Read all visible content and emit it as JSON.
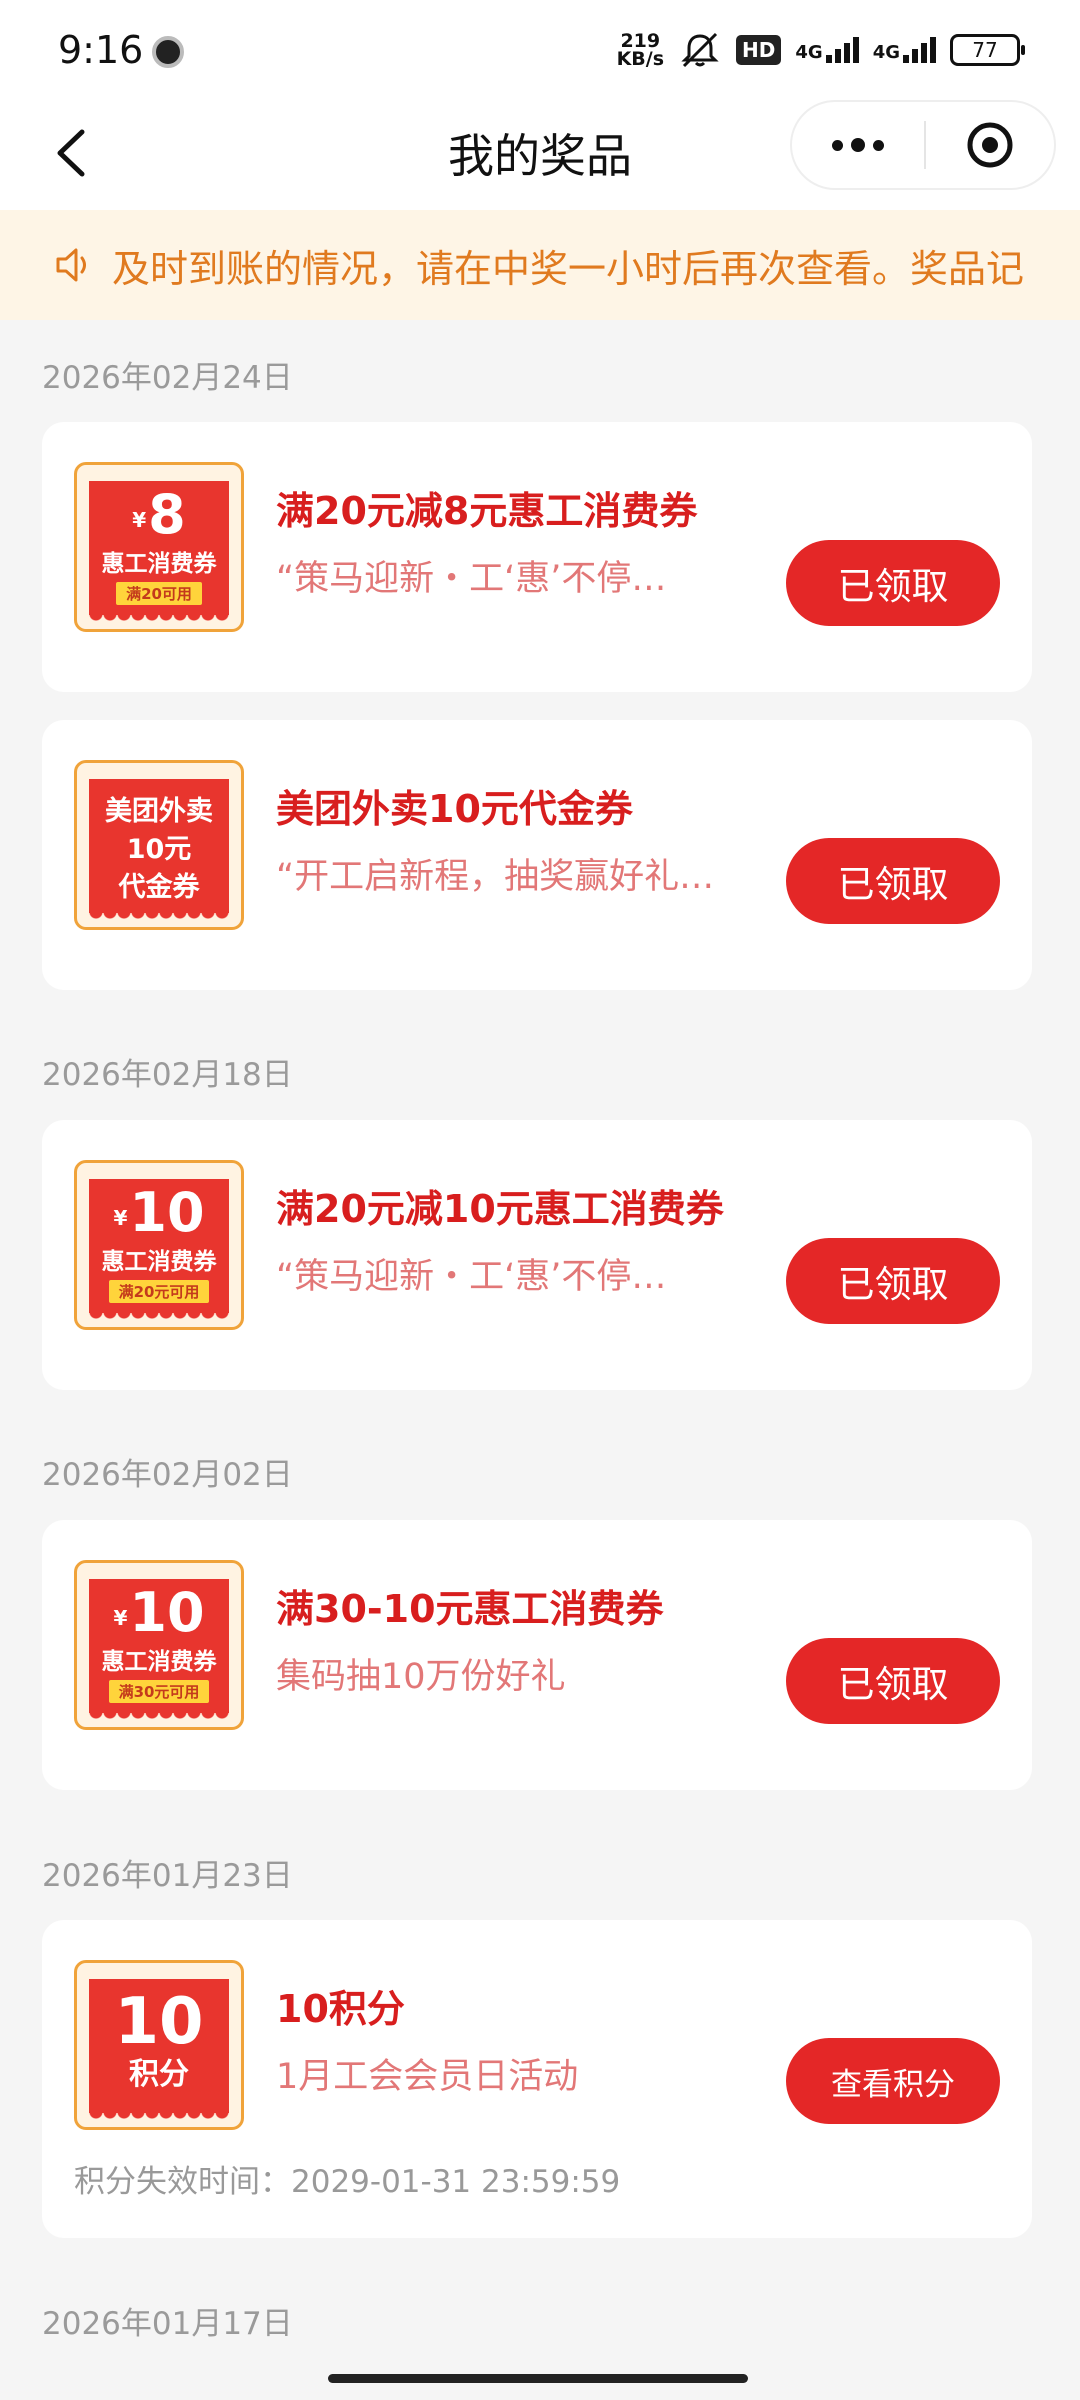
{
  "status_bar": {
    "time": "9:16",
    "net_speed_value": "219",
    "net_speed_unit": "KB/s",
    "hd_label": "HD",
    "signal_1": "4G",
    "signal_2": "4G",
    "battery": "77"
  },
  "nav": {
    "title": "我的奖品"
  },
  "notice": {
    "text": "及时到账的情况，请在中奖一小时后再次查看。奖品记"
  },
  "groups": [
    {
      "date": "2026年02月24日",
      "items": [
        {
          "thumb_amount": "8",
          "thumb_currency": "¥",
          "thumb_name": "惠工消费券",
          "thumb_cond": "满20可用",
          "title": "满20元减8元惠工消费券",
          "subtitle": "“策马迎新・工‘惠’不停…",
          "button": "已领取"
        },
        {
          "thumb_line1": "美团外卖",
          "thumb_line2": "10元",
          "thumb_line3": "代金券",
          "title": "美团外卖10元代金券",
          "subtitle": "“开工启新程，抽奖赢好礼…",
          "button": "已领取"
        }
      ]
    },
    {
      "date": "2026年02月18日",
      "items": [
        {
          "thumb_amount": "10",
          "thumb_currency": "¥",
          "thumb_name": "惠工消费券",
          "thumb_cond": "满20元可用",
          "title": "满20元减10元惠工消费券",
          "subtitle": "“策马迎新・工‘惠’不停…",
          "button": "已领取"
        }
      ]
    },
    {
      "date": "2026年02月02日",
      "items": [
        {
          "thumb_amount": "10",
          "thumb_currency": "¥",
          "thumb_name": "惠工消费券",
          "thumb_cond": "满30元可用",
          "title": "满30-10元惠工消费券",
          "subtitle": "集码抽10万份好礼",
          "button": "已领取"
        }
      ]
    },
    {
      "date": "2026年01月23日",
      "items": [
        {
          "thumb_amount": "10",
          "thumb_unit": "积分",
          "title": "10积分",
          "subtitle": "1月工会会员日活动",
          "button": "查看积分",
          "expiry": "积分失效时间：2029-01-31 23:59:59"
        }
      ]
    },
    {
      "date": "2026年01月17日",
      "items": []
    }
  ],
  "colors": {
    "accent": "#e42727",
    "title_red": "#d81e1e",
    "notice_orange": "#e07a1f",
    "notice_bg": "#fef5e6"
  }
}
